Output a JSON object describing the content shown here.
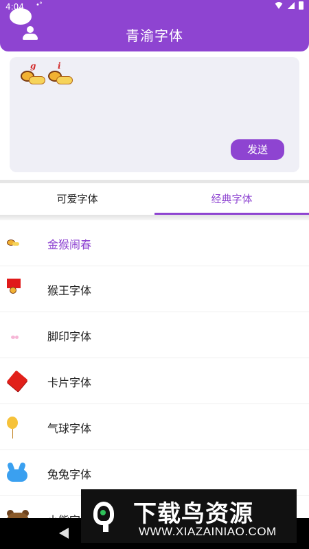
{
  "status": {
    "time": "4:04",
    "dots": "•°"
  },
  "header": {
    "title": "青渝字体"
  },
  "preview": {
    "sample_letters": [
      "g",
      "i"
    ],
    "send_label": "发送"
  },
  "tabs": [
    {
      "label": "可爱字体",
      "active": false
    },
    {
      "label": "经典字体",
      "active": true
    }
  ],
  "fonts": [
    {
      "name": "金猴闹春",
      "icon": "monkey-icon",
      "selected": true
    },
    {
      "name": "猴王字体",
      "icon": "monkey-king-flag-icon",
      "selected": false
    },
    {
      "name": "脚印字体",
      "icon": "footprint-icon",
      "selected": false
    },
    {
      "name": "卡片字体",
      "icon": "red-card-icon",
      "selected": false
    },
    {
      "name": "气球字体",
      "icon": "balloon-icon",
      "selected": false
    },
    {
      "name": "兔兔字体",
      "icon": "rabbit-icon",
      "selected": false
    },
    {
      "name": "小熊字",
      "icon": "bear-icon",
      "selected": false
    }
  ],
  "watermark": {
    "title": "下载鸟资源",
    "url": "WWW.XIAZAINIAO.COM"
  },
  "colors": {
    "accent": "#8e44d1",
    "preview_bg": "#efeff6"
  }
}
